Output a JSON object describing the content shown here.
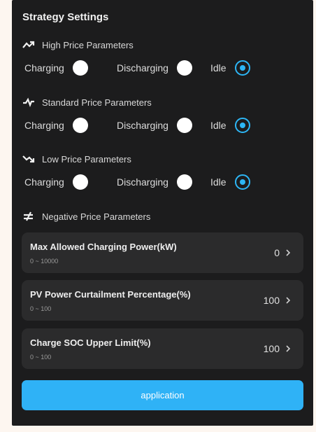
{
  "title": "Strategy Settings",
  "sections": [
    {
      "icon": "trend-up-icon",
      "label": "High Price Parameters",
      "options": [
        {
          "label": "Charging",
          "selected": false
        },
        {
          "label": "Discharging",
          "selected": false
        },
        {
          "label": "Idle",
          "selected": true
        }
      ]
    },
    {
      "icon": "pulse-icon",
      "label": "Standard Price Parameters",
      "options": [
        {
          "label": "Charging",
          "selected": false
        },
        {
          "label": "Discharging",
          "selected": false
        },
        {
          "label": "Idle",
          "selected": true
        }
      ]
    },
    {
      "icon": "trend-down-icon",
      "label": "Low Price Parameters",
      "options": [
        {
          "label": "Charging",
          "selected": false
        },
        {
          "label": "Discharging",
          "selected": false
        },
        {
          "label": "Idle",
          "selected": true
        }
      ]
    },
    {
      "icon": "not-equal-icon",
      "label": "Negative Price Parameters"
    }
  ],
  "settings": [
    {
      "label": "Max Allowed Charging Power(kW)",
      "range": "0 ~ 10000",
      "value": "0"
    },
    {
      "label": "PV Power Curtailment Percentage(%)",
      "range": "0 ~ 100",
      "value": "100"
    },
    {
      "label": "Charge SOC Upper Limit(%)",
      "range": "0 ~ 100",
      "value": "100"
    }
  ],
  "apply_label": "application",
  "colors": {
    "panel": "#1c1c1d",
    "card": "#2b2b2c",
    "accent": "#2fb2f6"
  }
}
